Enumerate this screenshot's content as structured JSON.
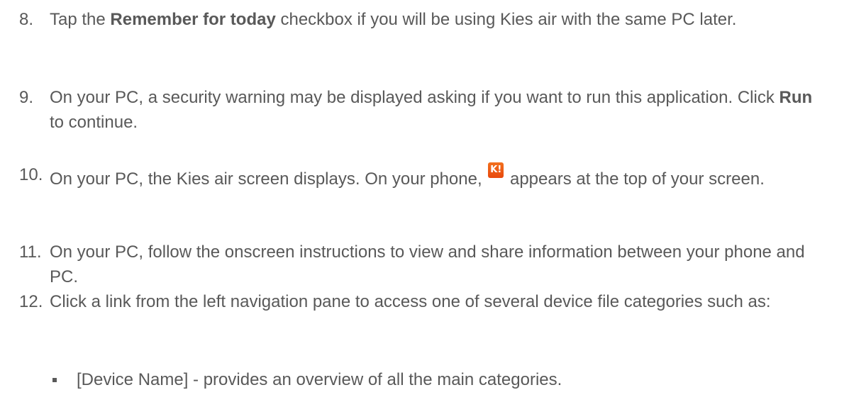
{
  "steps": [
    {
      "number": "8.",
      "before": "Tap the ",
      "bold": "Remember for today",
      "after": " checkbox if you will be using Kies air with the same PC later."
    },
    {
      "number": "9.",
      "before": "On your PC, a security warning may be displayed asking if you want to run this application. Click ",
      "bold": "Run",
      "after": " to continue."
    },
    {
      "number": "10.",
      "before": "On your PC, the Kies air screen displays. On your phone, ",
      "icon": "kies-air-app-icon",
      "icon_glyph": "K!",
      "after": " appears at the top of your screen."
    },
    {
      "number": "11.",
      "text": "On your PC, follow the onscreen instructions to view and share information between your phone and PC."
    },
    {
      "number": "12.",
      "text": "Click a link from the left navigation pane to access one of several device file categories such as:"
    }
  ],
  "bullets": [
    {
      "text": "[Device Name] - provides an overview of all the main categories."
    }
  ],
  "colors": {
    "body_text": "#595959",
    "icon_background": "#e8490e"
  }
}
